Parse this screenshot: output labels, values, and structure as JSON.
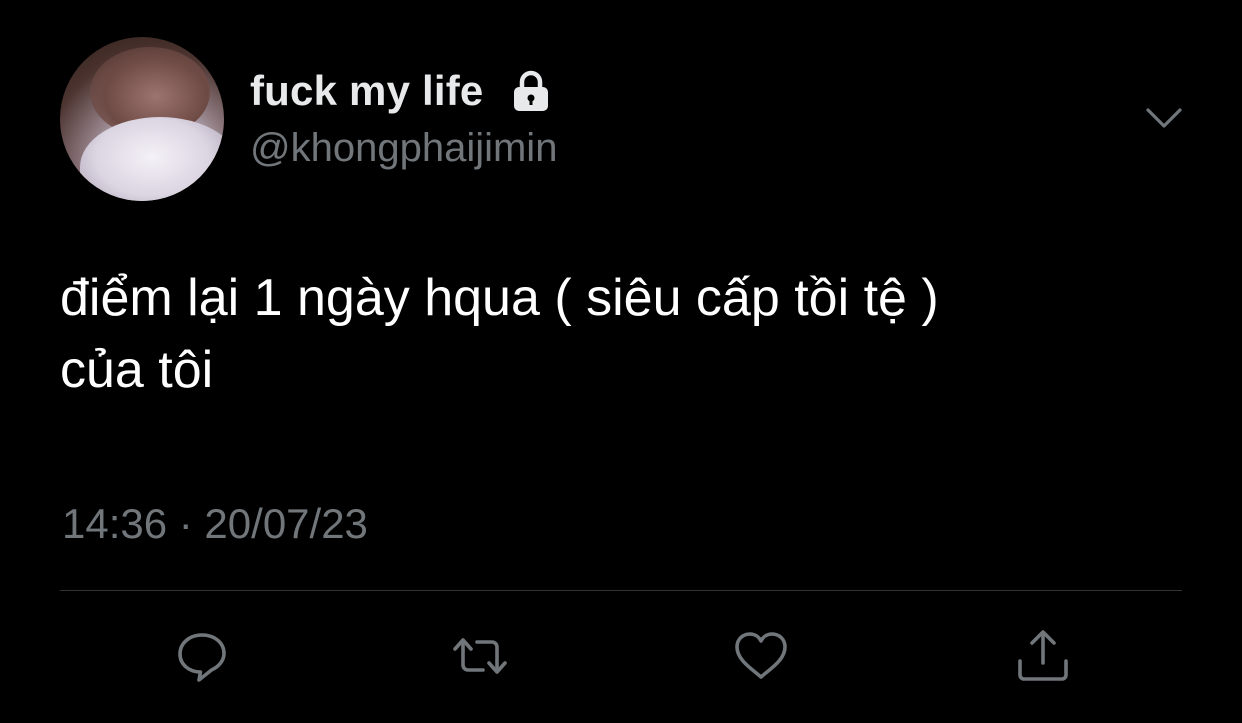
{
  "author": {
    "display_name": "fuck my life",
    "handle": "@khongphaijimin",
    "avatar_icon": "avatar-photo",
    "protected_icon": "lock-icon"
  },
  "tweet": {
    "text_lines": [
      "điểm lại 1 ngày hqua ( siêu cấp tồi tệ )",
      "của tôi"
    ],
    "timestamp": "14:36 · 20/07/23"
  },
  "menu": {
    "icon": "chevron-down-icon"
  },
  "actions": [
    {
      "name": "reply",
      "icon": "reply-icon"
    },
    {
      "name": "retweet",
      "icon": "retweet-icon"
    },
    {
      "name": "like",
      "icon": "heart-icon"
    },
    {
      "name": "share",
      "icon": "share-icon"
    }
  ],
  "colors": {
    "background": "#000000",
    "primary_text": "#ffffff",
    "secondary_text": "#71767b",
    "divider": "#2f3336"
  }
}
